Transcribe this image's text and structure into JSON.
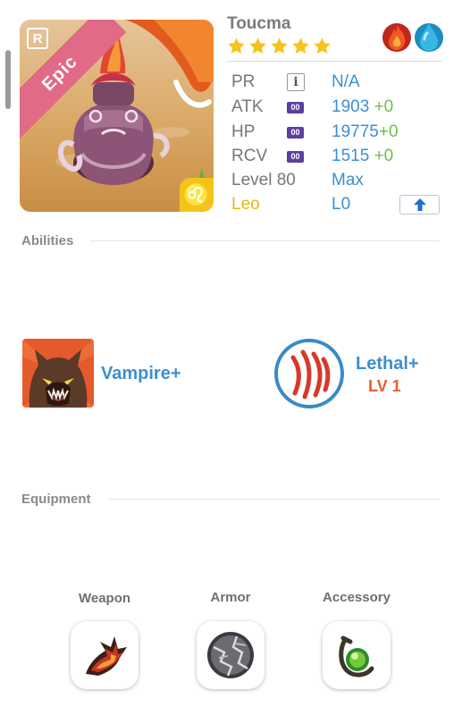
{
  "character": {
    "name": "Toucma",
    "stars": 5,
    "rarity_label": "Epic",
    "rarity_badge": "R",
    "zodiac_symbol": "♌",
    "elements": [
      "fire",
      "water"
    ]
  },
  "stats": {
    "pr": {
      "label": "PR",
      "value": "N/A"
    },
    "atk": {
      "label": "ATK",
      "chip": "00",
      "value": "1903",
      "bonus": "+0"
    },
    "hp": {
      "label": "HP",
      "chip": "00",
      "value": "19775",
      "bonus": "+0"
    },
    "rcv": {
      "label": "RCV",
      "chip": "00",
      "value": "1515",
      "bonus": "+0"
    },
    "level": {
      "label": "Level 80",
      "value": "Max"
    },
    "sign": {
      "label": "Leo",
      "value": "L0"
    }
  },
  "abilities": {
    "title": "Abilities",
    "items": [
      {
        "name": "Vampire+",
        "icon": "werewolf-icon"
      },
      {
        "name": "Lethal+",
        "level": "LV 1",
        "icon": "claw-marks-icon"
      }
    ]
  },
  "equipment": {
    "title": "Equipment",
    "slots": [
      {
        "label": "Weapon",
        "icon": "flame-claw-icon"
      },
      {
        "label": "Armor",
        "icon": "cracked-shield-icon"
      },
      {
        "label": "Accessory",
        "icon": "green-orb-icon"
      }
    ]
  },
  "colors": {
    "accent_blue": "#3d8fcf",
    "bonus_green": "#6cbf4a",
    "level_orange": "#e2622a",
    "star_gold": "#f7c21e",
    "epic_pink": "#e16a86",
    "zodiac_gold": "#e9b80e"
  }
}
